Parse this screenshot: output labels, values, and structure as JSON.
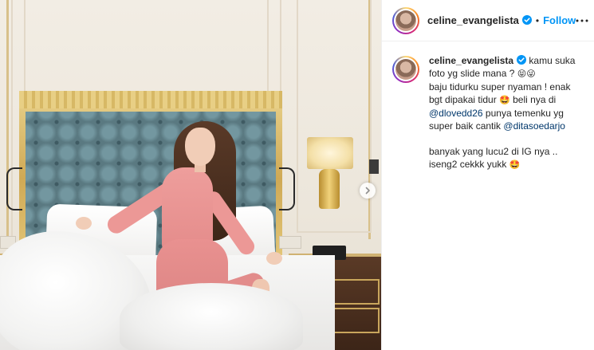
{
  "post": {
    "username": "celine_evangelista",
    "header_separator": "•",
    "follow_label": "Follow",
    "caption": {
      "line1_text": "kamu suka foto yg slide mana ?",
      "line1_emojis": "😝😜",
      "line2_text": "baju tidurku super nyaman ! enak bgt dipakai tidur",
      "line2_emoji": "🤩",
      "line2_after": "beli nya di",
      "mention1": "@dlovedd26",
      "mid_text": "punya temenku yg super baik cantik",
      "mention2": "@ditasoedarjo",
      "line3_text": "banyak yang lucu2 di IG nya .. iseng2 cekkk yukk",
      "line3_emoji": "🤩"
    }
  },
  "colors": {
    "accent": "#0095f6",
    "mention": "#00376b",
    "text": "#262626"
  },
  "icons": {
    "verified": "verified-badge-icon",
    "more": "more-options-icon",
    "carousel": "chevron-right-icon"
  }
}
